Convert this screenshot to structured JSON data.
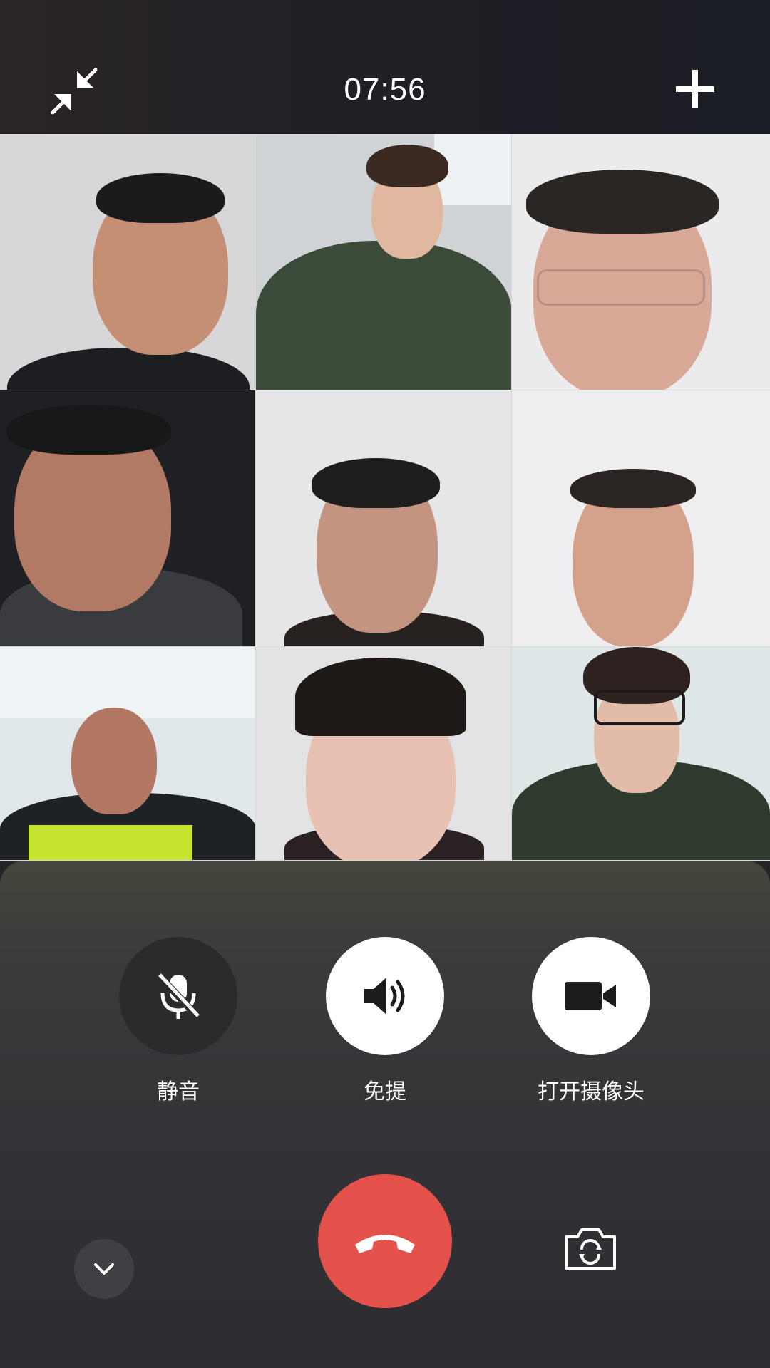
{
  "call": {
    "timer": "07:56",
    "participant_count": 9
  },
  "topbar": {
    "minimize_icon": "minimize-arrows-icon",
    "add_icon": "plus-icon"
  },
  "controls": {
    "mute": {
      "label": "静音",
      "icon": "microphone-off-icon",
      "state": "on"
    },
    "speaker": {
      "label": "免提",
      "icon": "speaker-icon",
      "state": "off"
    },
    "camera": {
      "label": "打开摄像头",
      "icon": "video-camera-icon",
      "state": "off"
    }
  },
  "bottom": {
    "collapse_icon": "chevron-down-icon",
    "hangup_icon": "phone-hangup-icon",
    "flip_camera_icon": "flip-camera-icon"
  },
  "colors": {
    "hangup": "#e4514a",
    "active_toggle": "#2b2b2d",
    "inactive_toggle": "#ffffff"
  }
}
